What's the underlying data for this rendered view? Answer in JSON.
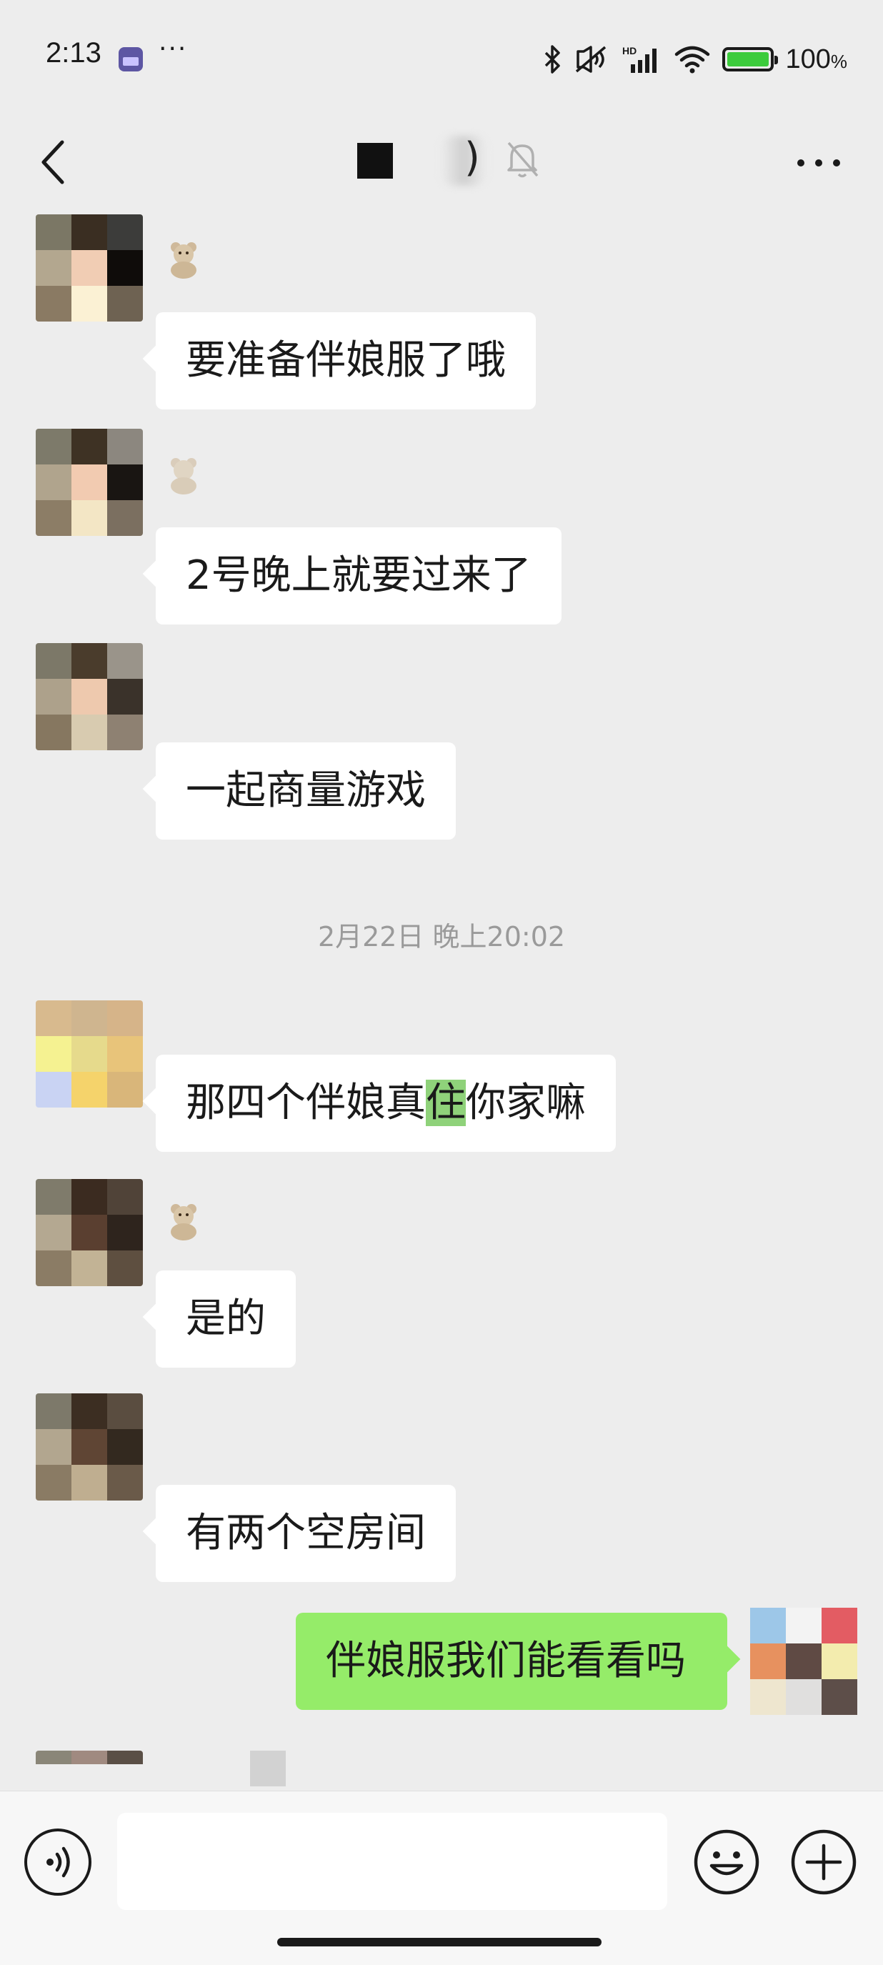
{
  "status_bar": {
    "time": "2:13",
    "calendar_date": "22",
    "more": "···",
    "battery": "100",
    "battery_unit": "%",
    "icons": [
      "bluetooth-icon",
      "mute-vibrate-icon",
      "hd-signal-icon",
      "wifi-icon",
      "battery-charging-icon"
    ]
  },
  "header": {
    "title_paren": ")",
    "back_icon": "chevron-left-icon",
    "mute_icon": "bell-muted-icon",
    "more_icon": "more-dots-icon"
  },
  "messages": [
    {
      "text": "要准备伴娘服了哦"
    },
    {
      "text": "2号晚上就要过来了"
    },
    {
      "text": "一起商量游戏"
    },
    {
      "text_before": "那四个伴娘真",
      "text_highlight": "住",
      "text_after": "你家嘛"
    },
    {
      "text": "是的"
    },
    {
      "text": "有两个空房间"
    }
  ],
  "timestamp": "2月22日 晚上20:02",
  "my_message": "伴娘服我们能看看吗",
  "input_bar": {
    "placeholder": "",
    "voice_icon": "voice-icon",
    "emoji_icon": "emoji-icon",
    "plus_icon": "plus-icon"
  },
  "colors": {
    "background": "#ededed",
    "my_bubble": "#95ec69",
    "highlight": "#8fd27a",
    "battery": "#3ccb3c"
  }
}
